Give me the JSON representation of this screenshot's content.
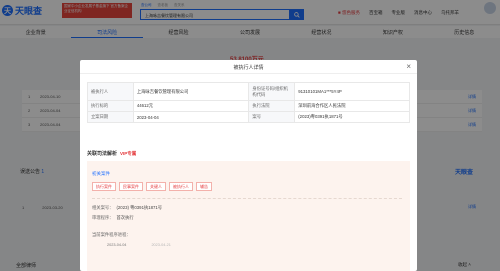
{
  "topbar": {
    "logo_mark": "天",
    "logo_text": "天眼查",
    "promo_text": "国家中小企业发展子基金旗下 官方备案企业征信机构",
    "search_tabs": [
      "查公司",
      "查老板",
      "查关系"
    ],
    "search_value": "上海咏吉餐饮管理有限公司",
    "search_icon": "magnifier-icon",
    "nav": [
      "■ 悠色服务",
      "百宝箱",
      "专业版",
      "消息中心",
      "乌托邦羊"
    ]
  },
  "tabs": [
    {
      "label": "企业背景",
      "active": false
    },
    {
      "label": "司法风险",
      "active": true
    },
    {
      "label": "经营风险",
      "active": false
    },
    {
      "label": "公司发展",
      "active": false
    },
    {
      "label": "经营状况",
      "active": false
    },
    {
      "label": "知识产权",
      "active": false
    },
    {
      "label": "历史信息",
      "active": false
    }
  ],
  "background": {
    "amount": "53.8100万元",
    "rows": [
      {
        "num": "1",
        "date": "2023-04-10",
        "detail": "详情"
      },
      {
        "num": "2",
        "date": "2023-04-04",
        "detail": "详情"
      },
      {
        "num": "3",
        "date": "2023-04-04",
        "detail": "详情"
      }
    ],
    "section_title": "误送公告",
    "section_count": "1",
    "brand": "天眼查",
    "row2": {
      "num": "1",
      "date": "2023-03-20",
      "company": "上海咏吉餐饮管理有限公司",
      "detail": "详情"
    },
    "bottom_left": "全部律师",
    "bottom_right": "收起 ˄"
  },
  "modal": {
    "title": "被执行人详情",
    "close_icon": "close-icon",
    "rows": [
      {
        "label1": "被执行人",
        "value1": "上海咏吉餐饮管理有限公司",
        "label2": "身份证号码/组织机构代码",
        "value2": "91310101MA1***5Y4P"
      },
      {
        "label1": "执行标的",
        "value1": "44612元",
        "label2": "执行法院",
        "value2": "深圳前海合作区人民法院"
      },
      {
        "label1": "立案日期",
        "value1": "2023-04-04",
        "label2": "案号",
        "value2": "(2023)粤0391执1871号"
      }
    ],
    "assoc_title": "关联司法解析",
    "assoc_vip": "VIP专属",
    "assoc_sub": "初关案件",
    "tags": [
      "执行案件",
      "民事案件",
      "关键人",
      "被执行人",
      "辅告"
    ],
    "case_no_label": "相关案号：",
    "case_no_value": "(2023) 粤0391执1871号",
    "procedure_label": "审理程序：",
    "procedure_value": "首次执行",
    "progress_label": "当前案件程序进程：",
    "progress_dates": [
      "2023-04-04",
      "2023-04-21"
    ]
  },
  "colors": {
    "brand_blue": "#1e6fff",
    "accent_red": "#e4393c",
    "panel_bg": "#fdf3ee"
  }
}
